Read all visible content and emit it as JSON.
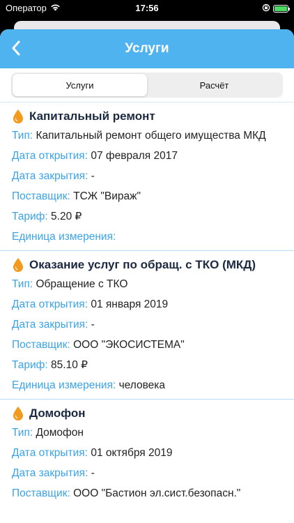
{
  "status_bar": {
    "carrier": "Оператор",
    "time": "17:56"
  },
  "nav": {
    "title": "Услуги"
  },
  "segments": [
    {
      "label": "Услуги",
      "active": true
    },
    {
      "label": "Расчёт",
      "active": false
    }
  ],
  "labels": {
    "type": "Тип:",
    "opened": "Дата открытия:",
    "closed": "Дата закрытия:",
    "supplier": "Поставщик:",
    "tariff": "Тариф:",
    "unit": "Единица измерения:"
  },
  "services": [
    {
      "title": "Капитальный ремонт",
      "type": "Капитальный ремонт общего имущества МКД",
      "opened": "07 февраля 2017",
      "closed": "-",
      "supplier": "ТСЖ \"Вираж\"",
      "tariff": "5.20 ₽",
      "unit": ""
    },
    {
      "title": "Оказание услуг по обращ. с ТКО (МКД)",
      "type": "Обращение с ТКО",
      "opened": "01 января 2019",
      "closed": "-",
      "supplier": "ООО \"ЭКОСИСТЕМА\"",
      "tariff": "85.10 ₽",
      "unit": "человека"
    },
    {
      "title": "Домофон",
      "type": "Домофон",
      "opened": "01 октября 2019",
      "closed": "-",
      "supplier": "ООО \"Бастион эл.сист.безопасн.\""
    }
  ],
  "colors": {
    "nav": "#4fb3f0",
    "label": "#3aa3e8",
    "drop": "#f29a1e"
  }
}
